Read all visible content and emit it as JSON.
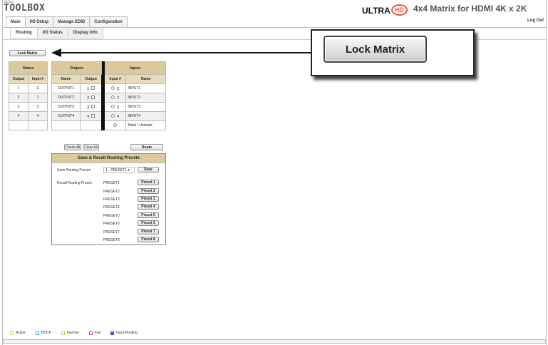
{
  "brand": {
    "small": "Gefen",
    "big": "TOOLBOX"
  },
  "header": {
    "logo_text": "ULTRA",
    "logo_badge": "HD",
    "title": "4x4 Matrix for HDMI 4K x 2K",
    "logout": "Log Out"
  },
  "main_tabs": [
    "Main",
    "I/O Setup",
    "Manage EDID",
    "Configuration"
  ],
  "sub_tabs": [
    "Routing",
    "I/O Status",
    "Display Info"
  ],
  "lock_button": "Lock Matrix",
  "callout_button": "Lock Matrix",
  "status_table": {
    "title": "Status",
    "headers": [
      "Output",
      "Input #"
    ],
    "rows": [
      [
        "1",
        "2"
      ],
      [
        "2",
        "1"
      ],
      [
        "3",
        "3"
      ],
      [
        "4",
        "4"
      ]
    ]
  },
  "routing": {
    "outputs_title": "Outputs",
    "inputs_title": "Inputs",
    "headers": [
      "Name",
      "Output",
      "Input #",
      "Name"
    ],
    "rows": [
      {
        "out_name": "OUTPUT1",
        "out_num": "1",
        "in_num": "1",
        "in_name": "INPUT1"
      },
      {
        "out_name": "OUTPUT2",
        "out_num": "2",
        "in_num": "2",
        "in_name": "INPUT2"
      },
      {
        "out_name": "OUTPUT3",
        "out_num": "3",
        "in_num": "3",
        "in_name": "INPUT3"
      },
      {
        "out_name": "OUTPUT4",
        "out_num": "4",
        "in_num": "4",
        "in_name": "INPUT4"
      }
    ],
    "mask_label": "Mask / Unmask",
    "check_all": "Check All",
    "clear_all": "Clear All",
    "route": "Route"
  },
  "presets": {
    "title": "Save & Recall Routing Presets",
    "save_label": "Save Routing Preset:",
    "save_value": "1 - PRESET1",
    "save_button": "Save",
    "recall_label": "Recall Routing Preset:",
    "items": [
      {
        "name": "PRESET1",
        "button": "Preset 1"
      },
      {
        "name": "PRESET2",
        "button": "Preset 2"
      },
      {
        "name": "PRESET3",
        "button": "Preset 3"
      },
      {
        "name": "PRESET4",
        "button": "Preset 4"
      },
      {
        "name": "PRESET5",
        "button": "Preset 5"
      },
      {
        "name": "PRESET6",
        "button": "Preset 6"
      },
      {
        "name": "PRESET7",
        "button": "Preset 7"
      },
      {
        "name": "PRESET8",
        "button": "Preset 8"
      }
    ]
  },
  "legend": [
    {
      "label": "Active",
      "color": "#c8d84a"
    },
    {
      "label": "HDCP",
      "color": "#4aa8d8"
    },
    {
      "label": "Inactive",
      "color": "#d8c84a"
    },
    {
      "label": "Fail",
      "color": "#e05050"
    },
    {
      "label": "Input Routing",
      "color": "#6a4ac8"
    }
  ]
}
